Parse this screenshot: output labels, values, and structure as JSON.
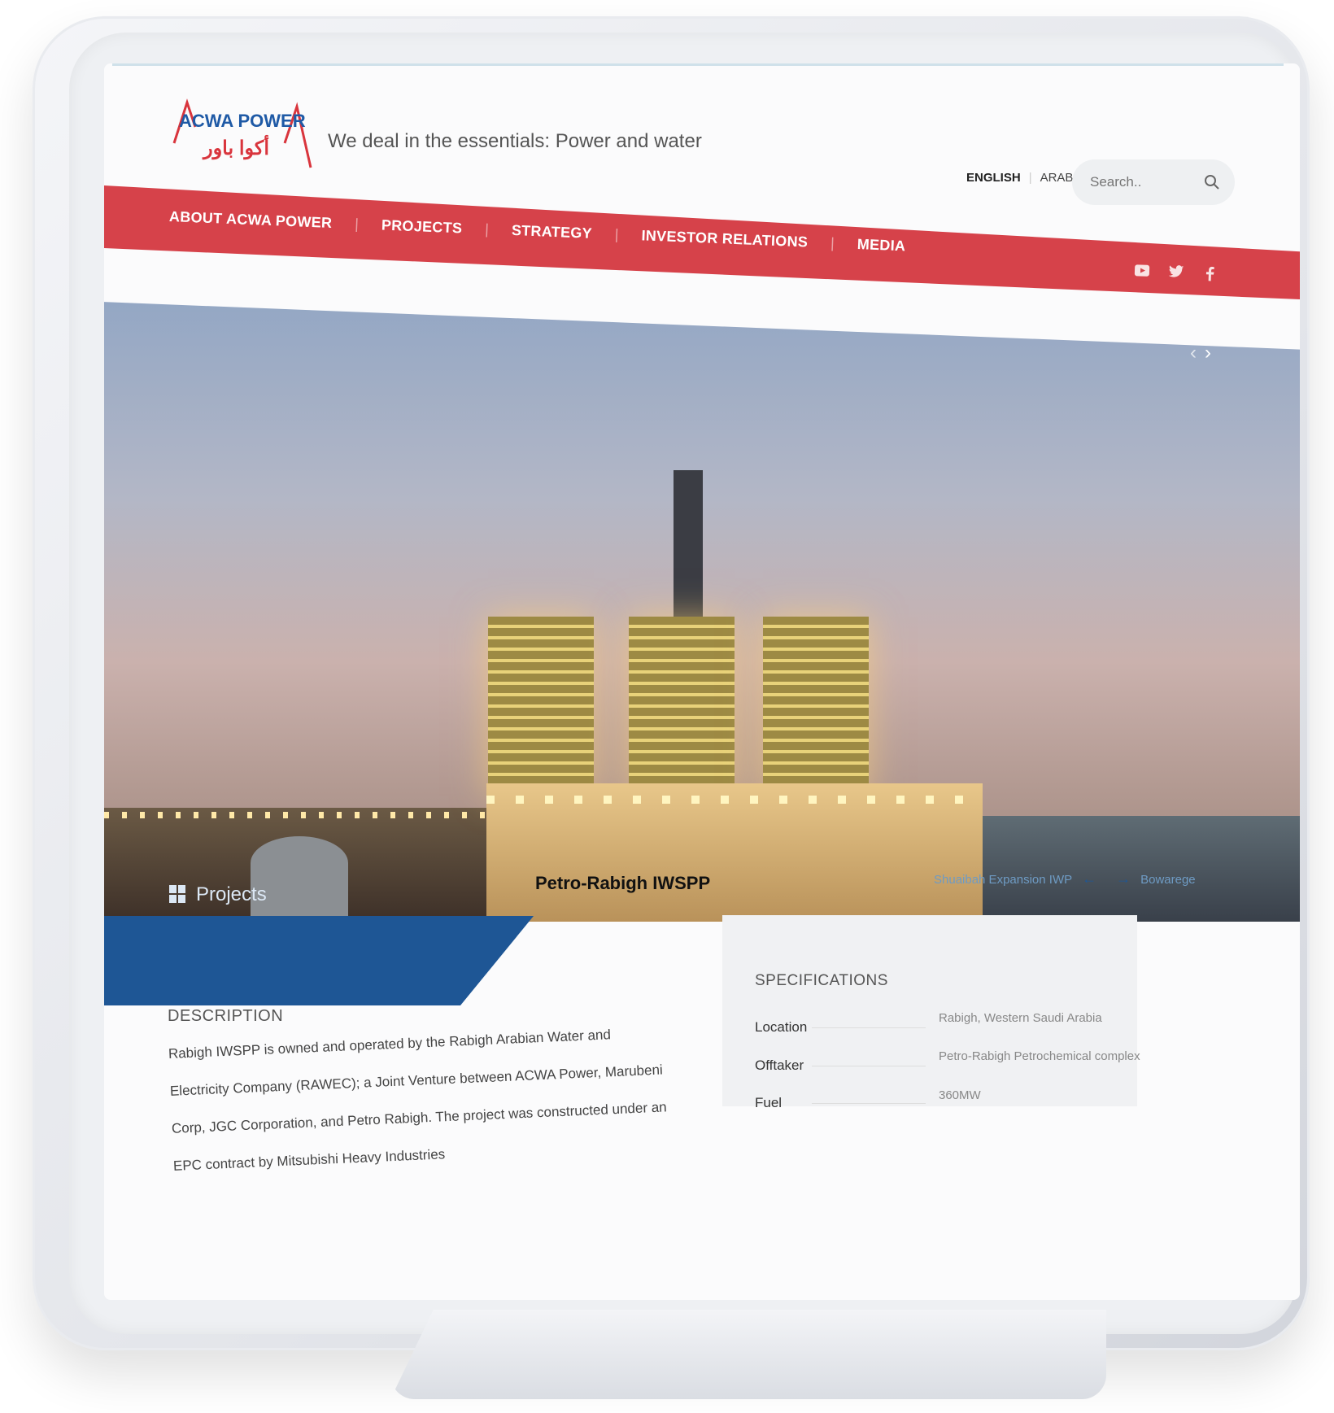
{
  "header": {
    "logo_text": "ACWA POWER",
    "logo_arabic": "أكوا باور",
    "tagline": "We deal in the essentials: Power and water",
    "lang_english": "ENGLISH",
    "lang_arabic": "ARABIC",
    "search_placeholder": "Search.."
  },
  "nav": {
    "items": [
      "ABOUT ACWA POWER",
      "PROJECTS",
      "STRATEGY",
      "INVESTOR RELATIONS",
      "MEDIA"
    ]
  },
  "social": [
    "youtube-icon",
    "twitter-icon",
    "facebook-icon"
  ],
  "hero": {
    "prev_label": "‹",
    "next_label": "›"
  },
  "banner": {
    "label": "Projects",
    "project_title": "Petro-Rabigh IWSPP",
    "prev_project": "Shuaibah Expansion IWP",
    "next_project": "Bowarege"
  },
  "specifications": {
    "title": "SPECIFICATIONS",
    "rows": [
      {
        "label": "Location",
        "value": "Rabigh, Western Saudi Arabia"
      },
      {
        "label": "Offtaker",
        "value": "Petro-Rabigh Petrochemical complex"
      },
      {
        "label": "Fuel",
        "value": "360MW"
      }
    ]
  },
  "description": {
    "title": "DESCRIPTION",
    "text": "Rabigh IWSPP is owned and operated by the Rabigh Arabian Water and Electricity Company (RAWEC); a Joint Venture between ACWA Power, Marubeni Corp, JGC Corporation, and Petro Rabigh. The project was constructed under an EPC contract by Mitsubishi Heavy Industries"
  },
  "colors": {
    "nav_red": "#d6424a",
    "banner_blue": "#1e5695",
    "logo_blue": "#1f5aa6"
  }
}
